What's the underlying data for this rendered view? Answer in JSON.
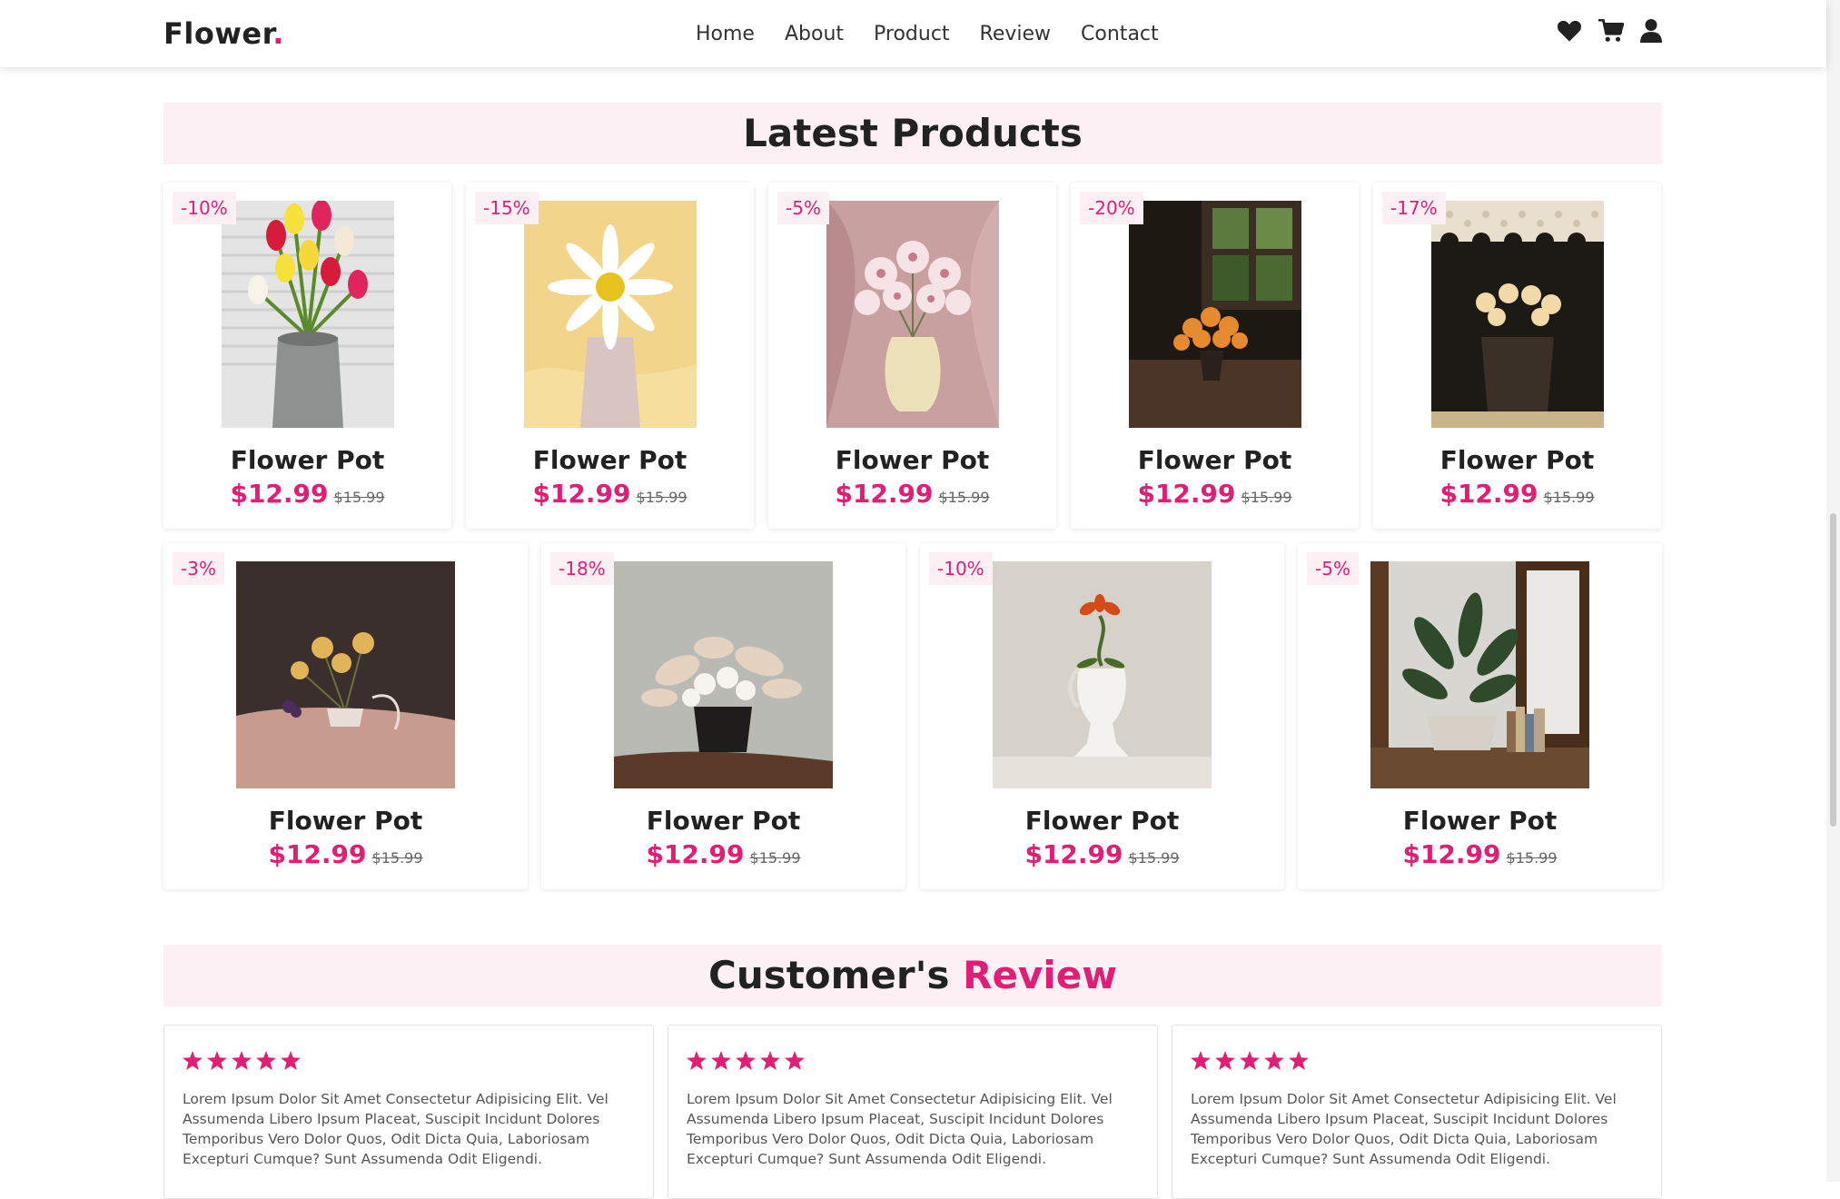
{
  "brand": {
    "name": "Flower",
    "dot": "."
  },
  "nav": [
    "Home",
    "About",
    "Product",
    "Review",
    "Contact"
  ],
  "icons": [
    "heart-icon",
    "cart-icon",
    "user-icon"
  ],
  "products_title": "Latest Products",
  "products": [
    {
      "discount": "-10%",
      "name": "Flower Pot",
      "price": "$12.99",
      "old_price": "$15.99"
    },
    {
      "discount": "-15%",
      "name": "Flower Pot",
      "price": "$12.99",
      "old_price": "$15.99"
    },
    {
      "discount": "-5%",
      "name": "Flower Pot",
      "price": "$12.99",
      "old_price": "$15.99"
    },
    {
      "discount": "-20%",
      "name": "Flower Pot",
      "price": "$12.99",
      "old_price": "$15.99"
    },
    {
      "discount": "-17%",
      "name": "Flower Pot",
      "price": "$12.99",
      "old_price": "$15.99"
    },
    {
      "discount": "-3%",
      "name": "Flower Pot",
      "price": "$12.99",
      "old_price": "$15.99"
    },
    {
      "discount": "-18%",
      "name": "Flower Pot",
      "price": "$12.99",
      "old_price": "$15.99"
    },
    {
      "discount": "-10%",
      "name": "Flower Pot",
      "price": "$12.99",
      "old_price": "$15.99"
    },
    {
      "discount": "-5%",
      "name": "Flower Pot",
      "price": "$12.99",
      "old_price": "$15.99"
    }
  ],
  "review_title": {
    "main": "Customer's",
    "accent": "Review"
  },
  "reviews": [
    {
      "rating": 5,
      "text": "Lorem Ipsum Dolor Sit Amet Consectetur Adipisicing Elit. Vel Assumenda Libero Ipsum Placeat, Suscipit Incidunt Dolores Temporibus Vero Dolor Quos, Odit Dicta Quia, Laboriosam Excepturi Cumque? Sunt Assumenda Odit Eligendi."
    },
    {
      "rating": 5,
      "text": "Lorem Ipsum Dolor Sit Amet Consectetur Adipisicing Elit. Vel Assumenda Libero Ipsum Placeat, Suscipit Incidunt Dolores Temporibus Vero Dolor Quos, Odit Dicta Quia, Laboriosam Excepturi Cumque? Sunt Assumenda Odit Eligendi."
    },
    {
      "rating": 5,
      "text": "Lorem Ipsum Dolor Sit Amet Consectetur Adipisicing Elit. Vel Assumenda Libero Ipsum Placeat, Suscipit Incidunt Dolores Temporibus Vero Dolor Quos, Odit Dicta Quia, Laboriosam Excepturi Cumque? Sunt Assumenda Odit Eligendi."
    }
  ],
  "colors": {
    "accent": "#e11d74",
    "section_bg": "#fdf0f5",
    "text": "#222222"
  }
}
